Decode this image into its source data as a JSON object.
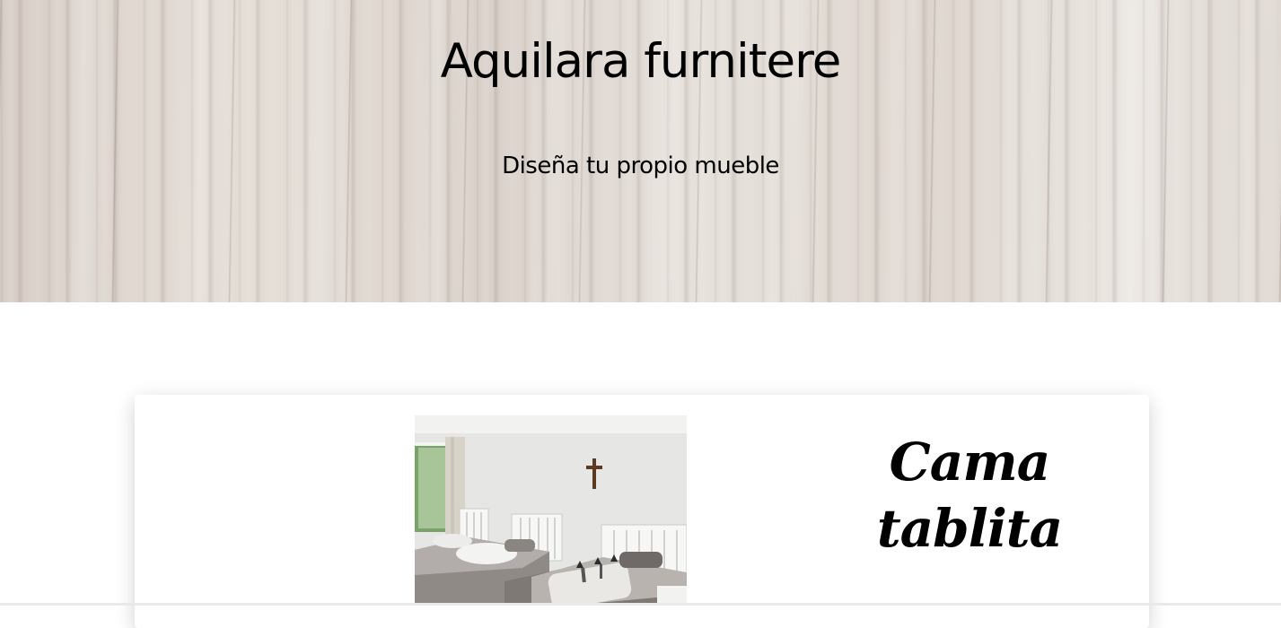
{
  "hero": {
    "title": "Aquilara furnitere",
    "subtitle": "Diseña tu propio mueble"
  },
  "product": {
    "image_icon": "bedroom-photo",
    "title_line1": "Cama",
    "title_line2": "tablita"
  },
  "colors": {
    "wood_base": "#ddd6d0",
    "text": "#000000",
    "background": "#ffffff"
  }
}
